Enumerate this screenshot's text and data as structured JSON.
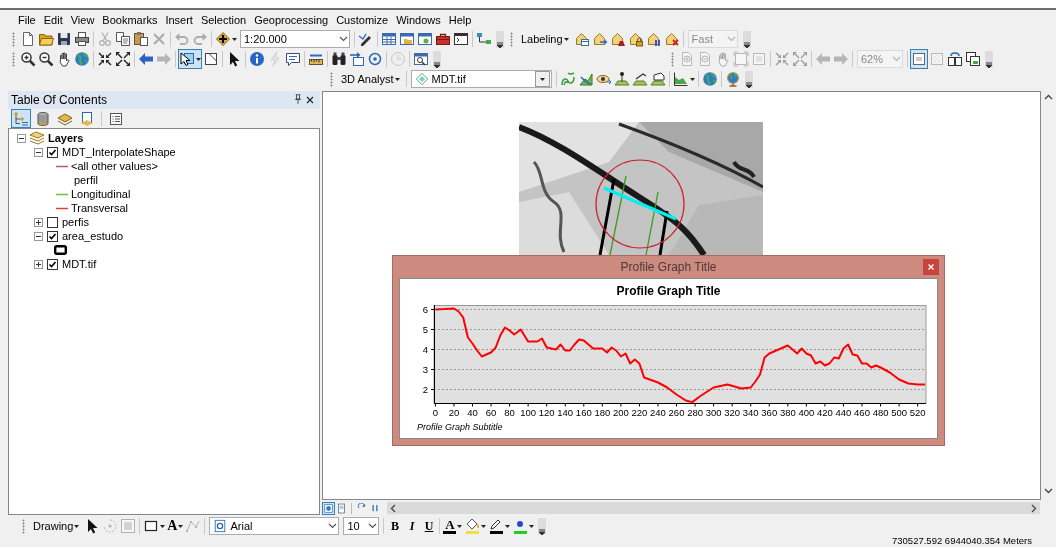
{
  "menu_bar": [
    "File",
    "Edit",
    "View",
    "Bookmarks",
    "Insert",
    "Selection",
    "Geoprocessing",
    "Customize",
    "Windows",
    "Help"
  ],
  "toolbars": [
    {
      "groups": [
        [
          {
            "kind": "tool",
            "disabled": false
          },
          {
            "kind": "tool",
            "disabled": false
          },
          {
            "kind": "tool",
            "disabled": false
          },
          {
            "kind": "tool",
            "disabled": false
          }
        ],
        [
          {
            "kind": "tool",
            "disabled": true
          },
          {
            "kind": "tool",
            "disabled": false
          },
          {
            "kind": "tool",
            "disabled": false
          },
          {
            "kind": "tool",
            "disabled": true
          }
        ],
        [
          {
            "kind": "tool",
            "disabled": true
          },
          {
            "kind": "tool",
            "disabled": true
          }
        ],
        [
          {
            "kind": "tool",
            "disabled": false
          },
          {
            "kind": "combo",
            "value": "1:20.000",
            "disabled": false
          }
        ],
        [
          {
            "kind": "tool",
            "disabled": false
          }
        ],
        [
          {
            "kind": "tool",
            "disabled": false
          },
          {
            "kind": "tool",
            "disabled": false
          },
          {
            "kind": "tool",
            "disabled": false
          },
          {
            "kind": "tool",
            "disabled": false
          },
          {
            "kind": "tool",
            "disabled": false
          }
        ],
        [
          {
            "kind": "tool",
            "disabled": false
          }
        ]
      ]
    },
    {
      "groups": [
        [
          {
            "kind": "menu",
            "label": "Labeling"
          },
          {
            "kind": "tool",
            "disabled": false
          },
          {
            "kind": "tool",
            "disabled": false
          },
          {
            "kind": "tool",
            "disabled": false
          },
          {
            "kind": "tool",
            "disabled": false
          },
          {
            "kind": "tool",
            "disabled": false
          },
          {
            "kind": "tool",
            "disabled": false
          }
        ],
        [
          {
            "kind": "combo",
            "value": "Fast",
            "disabled": true
          }
        ]
      ]
    },
    {
      "groups": [
        [
          {
            "kind": "tool",
            "disabled": false,
            "pressed": false
          },
          {
            "kind": "tool",
            "disabled": false,
            "pressed": false
          },
          {
            "kind": "tool",
            "disabled": false,
            "pressed": false
          },
          {
            "kind": "tool",
            "disabled": false,
            "pressed": false
          }
        ],
        [
          {
            "kind": "tool",
            "disabled": false,
            "pressed": false
          },
          {
            "kind": "tool",
            "disabled": false,
            "pressed": false
          }
        ],
        [
          {
            "kind": "tool",
            "disabled": false,
            "pressed": false
          },
          {
            "kind": "tool",
            "disabled": true,
            "pressed": false
          }
        ],
        [
          {
            "kind": "tool",
            "disabled": false,
            "pressed": true
          },
          {
            "kind": "tool",
            "disabled": false,
            "pressed": false
          }
        ],
        [
          {
            "kind": "tool",
            "disabled": false,
            "pressed": false
          }
        ],
        [
          {
            "kind": "tool",
            "disabled": false,
            "pressed": false
          },
          {
            "kind": "tool",
            "disabled": true,
            "pressed": false
          },
          {
            "kind": "tool",
            "disabled": false,
            "pressed": false
          }
        ],
        [
          {
            "kind": "tool",
            "disabled": false,
            "pressed": false
          }
        ],
        [
          {
            "kind": "tool",
            "disabled": false,
            "pressed": false
          },
          {
            "kind": "tool",
            "disabled": false,
            "pressed": false
          },
          {
            "kind": "tool",
            "disabled": false,
            "pressed": false
          }
        ],
        [
          {
            "kind": "tool",
            "disabled": true,
            "pressed": false
          }
        ],
        [
          {
            "kind": "tool",
            "disabled": false,
            "pressed": false
          }
        ]
      ]
    },
    {
      "groups": [
        [
          {
            "kind": "tool",
            "disabled": true,
            "pressed": false
          },
          {
            "kind": "tool",
            "disabled": true,
            "pressed": false
          },
          {
            "kind": "tool",
            "disabled": true,
            "pressed": false
          },
          {
            "kind": "tool",
            "disabled": true,
            "pressed": false
          },
          {
            "kind": "tool",
            "disabled": true,
            "pressed": false
          }
        ],
        [
          {
            "kind": "tool",
            "disabled": true,
            "pressed": false
          },
          {
            "kind": "tool",
            "disabled": true,
            "pressed": false
          }
        ],
        [
          {
            "kind": "tool",
            "disabled": true,
            "pressed": false
          },
          {
            "kind": "tool",
            "disabled": true,
            "pressed": false
          }
        ],
        [
          {
            "kind": "combo",
            "value": "62%",
            "disabled": true
          }
        ],
        [
          {
            "kind": "tool",
            "disabled": false,
            "pressed": true
          },
          {
            "kind": "tool",
            "disabled": true,
            "pressed": false
          },
          {
            "kind": "tool",
            "disabled": false,
            "pressed": false
          },
          {
            "kind": "tool",
            "disabled": false,
            "pressed": false
          }
        ]
      ]
    },
    {
      "groups": [
        [
          {
            "kind": "menu",
            "label": "3D Analyst"
          }
        ],
        [
          {
            "kind": "combo",
            "value": "MDT.tif",
            "disabled": false
          }
        ],
        [
          {
            "kind": "tool",
            "disabled": false
          },
          {
            "kind": "tool",
            "disabled": false
          },
          {
            "kind": "tool",
            "disabled": false
          },
          {
            "kind": "tool",
            "disabled": false
          },
          {
            "kind": "tool",
            "disabled": false
          },
          {
            "kind": "tool",
            "disabled": false
          }
        ],
        [
          {
            "kind": "tool",
            "disabled": false
          }
        ],
        [
          {
            "kind": "tool",
            "disabled": false
          }
        ],
        [
          {
            "kind": "tool",
            "disabled": false
          }
        ]
      ]
    }
  ],
  "table_of_contents": {
    "title": "Table Of Contents",
    "view_buttons": [
      {
        "selected": true
      },
      {
        "selected": false
      },
      {
        "selected": false
      },
      {
        "selected": false
      }
    ],
    "tree": {
      "label": "Layers",
      "expanded": true,
      "children": [
        {
          "label": "MDT_InterpolateShape",
          "checked": true,
          "expanded": true,
          "children": [
            {
              "kind": "line",
              "label": "<all other values>",
              "color": "#c4508c"
            },
            {
              "kind": "heading",
              "label": "perfil"
            },
            {
              "kind": "line",
              "label": "Longitudinal",
              "color": "#6cbf4a"
            },
            {
              "kind": "line",
              "label": "Transversal",
              "color": "#e83c3c"
            }
          ]
        },
        {
          "label": "perfis",
          "checked": false,
          "expanded": false
        },
        {
          "label": "area_estudo",
          "checked": true,
          "expanded": true,
          "children": [
            {
              "kind": "outline"
            }
          ]
        },
        {
          "label": "MDT.tif",
          "checked": true,
          "expanded": false
        }
      ]
    }
  },
  "map_view": {
    "view_buttons": [
      {
        "selected": true
      },
      {
        "selected": false
      }
    ]
  },
  "profile_graph_window": {
    "title": "Profile Graph Title",
    "chart_data": {
      "type": "line",
      "title": "Profile Graph Title",
      "x": [
        0,
        10,
        20,
        25,
        30,
        35,
        40,
        45,
        50,
        55,
        60,
        65,
        70,
        75,
        80,
        85,
        92,
        100,
        110,
        115,
        120,
        130,
        135,
        140,
        145,
        150,
        155,
        160,
        170,
        180,
        185,
        190,
        195,
        200,
        205,
        210,
        215,
        220,
        225,
        240,
        250,
        260,
        270,
        277,
        285,
        300,
        315,
        330,
        340,
        345,
        350,
        355,
        360,
        370,
        380,
        385,
        390,
        395,
        400,
        405,
        410,
        415,
        420,
        425,
        430,
        435,
        440,
        445,
        450,
        455,
        460,
        465,
        470,
        475,
        480,
        490,
        500,
        510,
        520,
        528
      ],
      "values": [
        6.0,
        6.02,
        6.05,
        5.9,
        5.6,
        4.6,
        4.3,
        3.95,
        3.65,
        3.75,
        3.85,
        4.1,
        4.7,
        5.1,
        4.95,
        4.75,
        5.0,
        4.4,
        4.4,
        4.55,
        4.1,
        4.0,
        4.25,
        3.95,
        3.95,
        4.25,
        4.5,
        4.45,
        4.05,
        4.05,
        3.85,
        4.1,
        3.95,
        3.65,
        3.8,
        3.3,
        3.5,
        3.3,
        2.6,
        2.35,
        2.1,
        1.75,
        1.45,
        1.37,
        1.65,
        2.1,
        2.25,
        2.05,
        2.1,
        2.4,
        2.75,
        3.6,
        3.8,
        4.0,
        4.2,
        4.0,
        3.8,
        4.05,
        3.8,
        3.7,
        3.3,
        3.4,
        3.2,
        3.3,
        3.6,
        3.55,
        4.05,
        4.25,
        3.75,
        3.7,
        3.3,
        3.3,
        3.1,
        3.2,
        3.1,
        2.85,
        2.5,
        2.3,
        2.25,
        2.25
      ],
      "xticks": [
        0,
        20,
        40,
        60,
        80,
        100,
        120,
        140,
        160,
        180,
        200,
        220,
        240,
        260,
        280,
        300,
        320,
        340,
        360,
        380,
        400,
        420,
        440,
        460,
        480,
        500,
        520
      ],
      "yticks": [
        2,
        3,
        4,
        5,
        6
      ],
      "xlim": [
        -1.5,
        529
      ],
      "ylim": [
        1.3,
        6.2
      ],
      "grid": true
    },
    "subtitle": "Profile Graph Subtitle"
  },
  "drawing_toolbar": {
    "groups": [
      [
        {
          "kind": "menu",
          "label": "Drawing"
        },
        {
          "kind": "tool",
          "disabled": false
        },
        {
          "kind": "tool",
          "disabled": true
        },
        {
          "kind": "tool",
          "disabled": true
        }
      ],
      [
        {
          "kind": "tool",
          "disabled": false
        },
        {
          "kind": "tool",
          "label": "A",
          "disabled": false
        },
        {
          "kind": "tool",
          "disabled": true
        }
      ],
      [
        {
          "kind": "combo",
          "value": "Arial",
          "disabled": false
        },
        {
          "kind": "combo",
          "value": "10",
          "disabled": false
        }
      ],
      [
        {
          "kind": "tool",
          "label": "B",
          "disabled": false
        },
        {
          "kind": "tool",
          "label": "I",
          "disabled": false
        },
        {
          "kind": "tool",
          "label": "U",
          "disabled": false
        }
      ],
      [
        {
          "kind": "tool",
          "label": "A",
          "disabled": false,
          "color": "#000000"
        },
        {
          "kind": "tool",
          "disabled": false,
          "color": "#f0e040"
        },
        {
          "kind": "tool",
          "disabled": false,
          "color": "#000000"
        },
        {
          "kind": "tool",
          "disabled": false,
          "color": "#20d020"
        }
      ]
    ]
  },
  "status_bar": {
    "coordinates": "730527.592 6944040.354 Meters"
  }
}
